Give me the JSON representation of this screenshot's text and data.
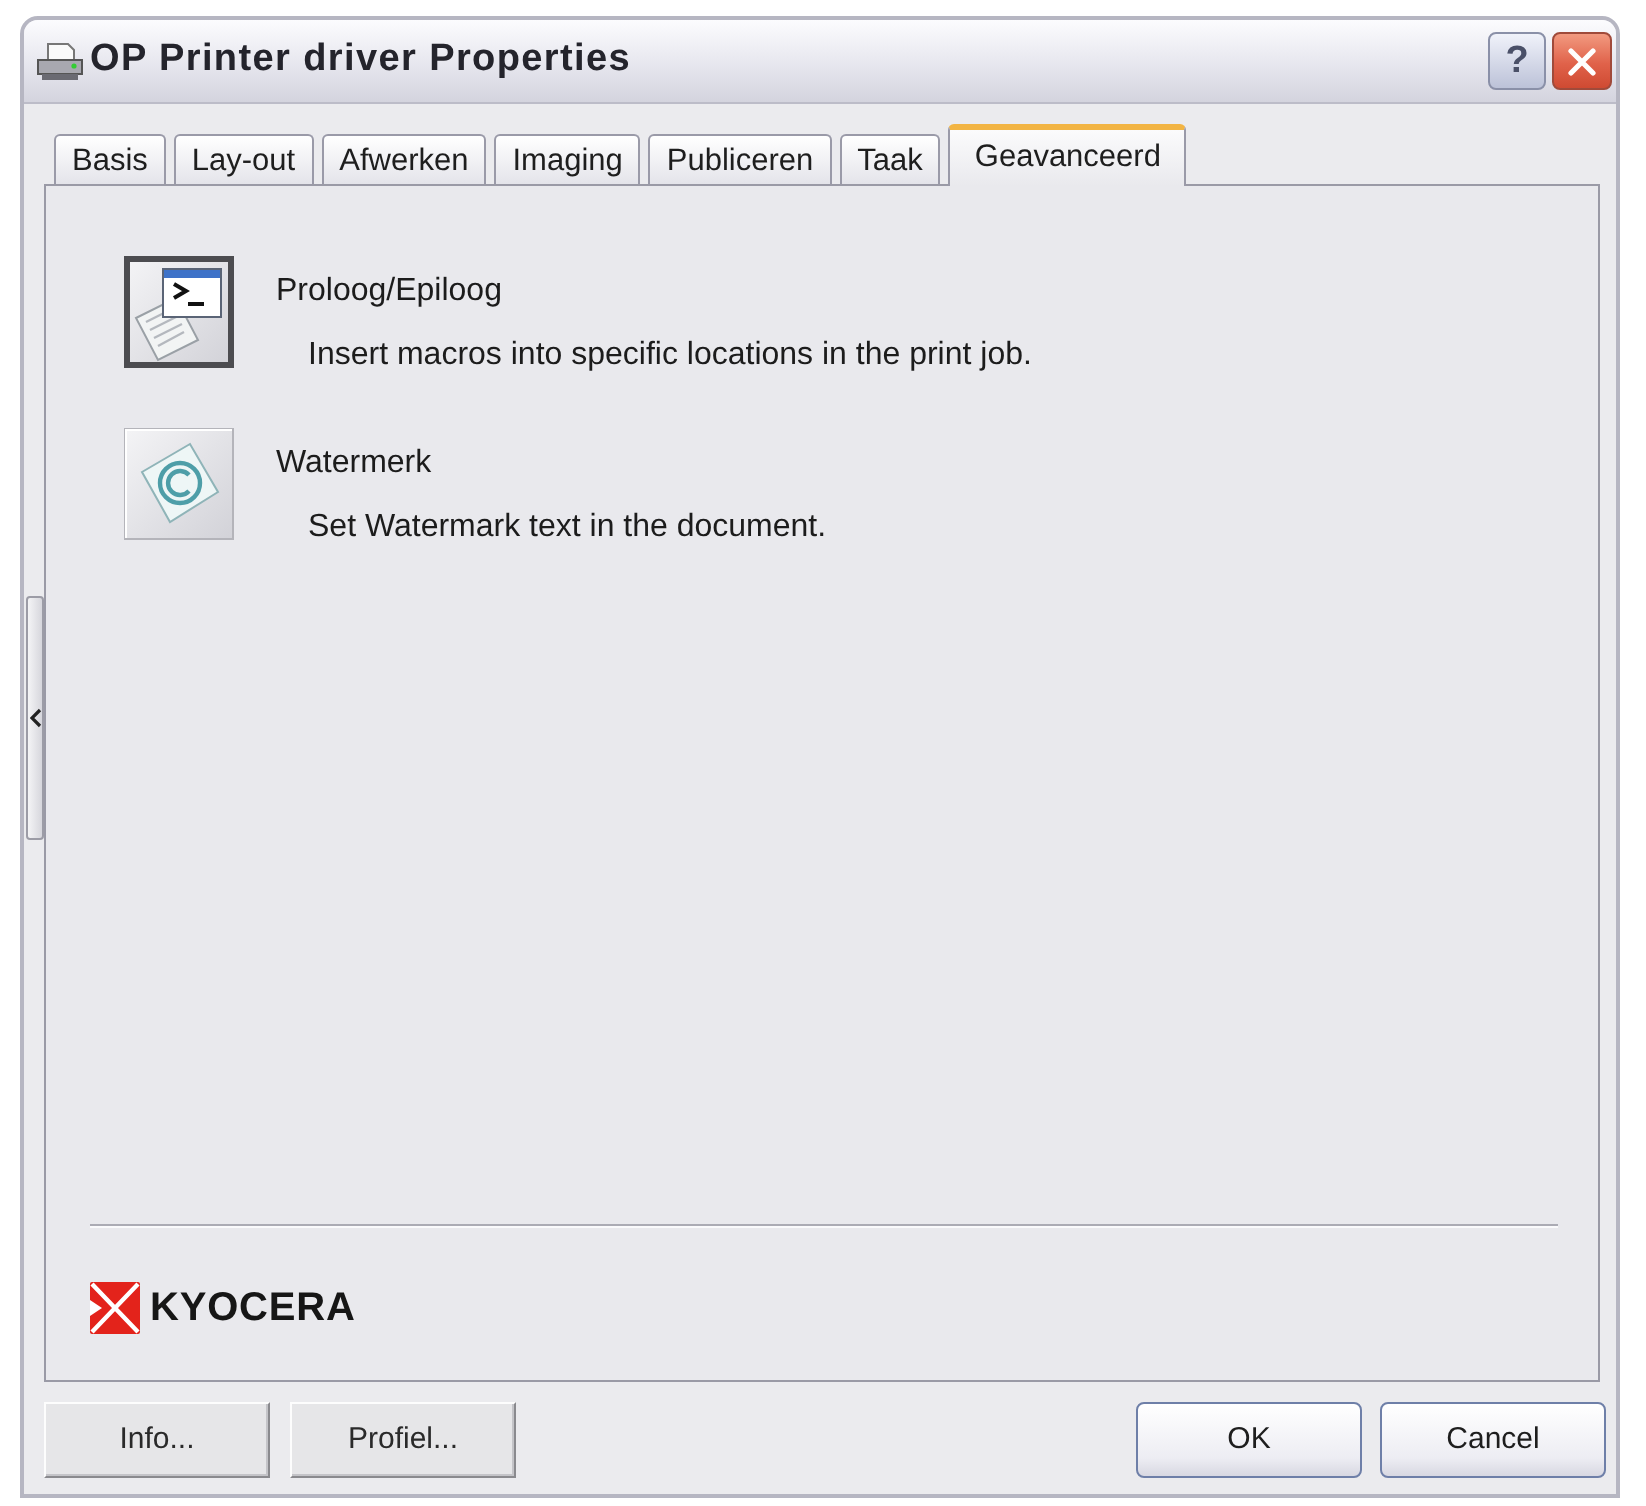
{
  "window": {
    "title": "OP Printer driver Properties",
    "help_label": "?"
  },
  "tabs": [
    {
      "label": "Basis",
      "selected": false
    },
    {
      "label": "Lay-out",
      "selected": false
    },
    {
      "label": "Afwerken",
      "selected": false
    },
    {
      "label": "Imaging",
      "selected": false
    },
    {
      "label": "Publiceren",
      "selected": false
    },
    {
      "label": "Taak",
      "selected": false
    },
    {
      "label": "Geavanceerd",
      "selected": true
    }
  ],
  "features": [
    {
      "kind": "terminal",
      "title": "Proloog/Epiloog",
      "description": "Insert macros into specific locations in the print job.",
      "selected": true
    },
    {
      "kind": "watermark",
      "title": "Watermerk",
      "description": "Set Watermark text in the document.",
      "selected": false
    }
  ],
  "logo": {
    "text": "KYOCERA"
  },
  "buttons_left": [
    "Info...",
    "Profiel..."
  ],
  "buttons_right": [
    "OK",
    "Cancel"
  ]
}
